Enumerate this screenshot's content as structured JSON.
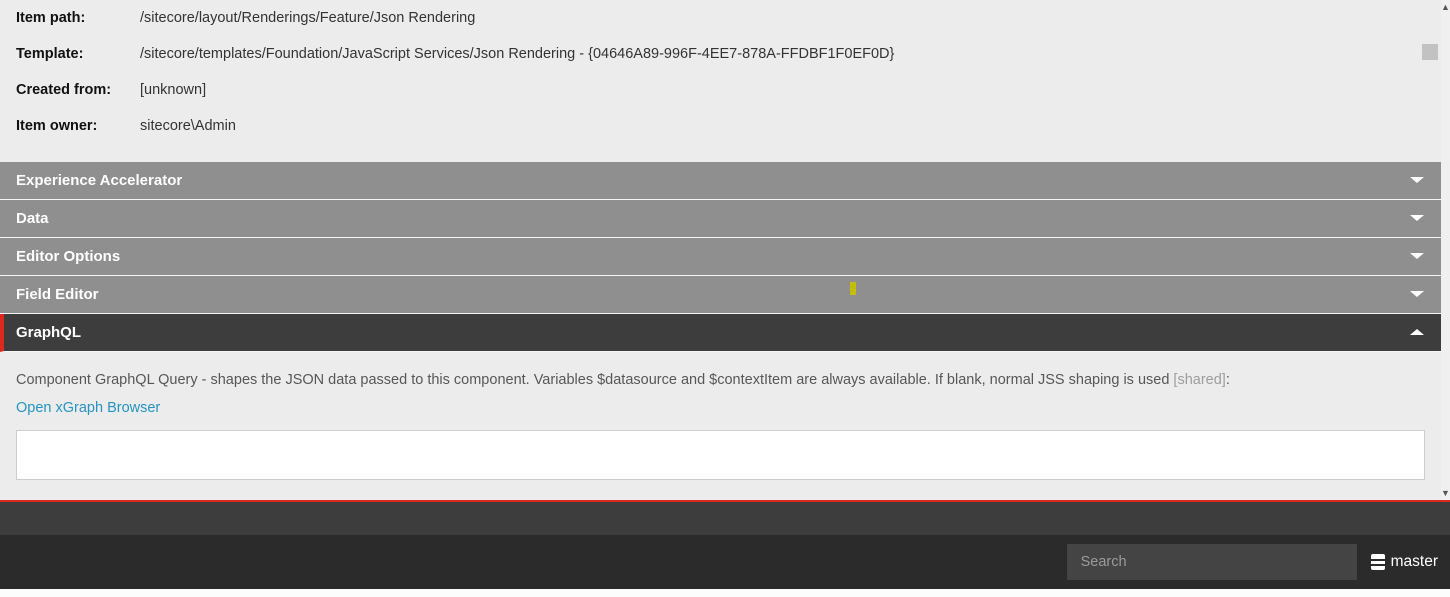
{
  "info": {
    "itemPath": {
      "label": "Item path:",
      "value": "/sitecore/layout/Renderings/Feature/Json Rendering"
    },
    "template": {
      "label": "Template:",
      "value": "/sitecore/templates/Foundation/JavaScript Services/Json Rendering - {04646A89-996F-4EE7-878A-FFDBF1F0EF0D}"
    },
    "createdFrom": {
      "label": "Created from:",
      "value": "[unknown]"
    },
    "itemOwner": {
      "label": "Item owner:",
      "value": "sitecore\\Admin"
    }
  },
  "sections": {
    "xa": "Experience Accelerator",
    "data": "Data",
    "editor": "Editor Options",
    "field": "Field Editor",
    "gql": "GraphQL"
  },
  "graphql": {
    "desc": "Component GraphQL Query - shapes the JSON data passed to this component. Variables $datasource and $contextItem are always available. If blank, normal JSS shaping is used ",
    "shared": "[shared]",
    "colon": ":",
    "link": "Open xGraph Browser",
    "value": ""
  },
  "footer": {
    "searchPlaceholder": "Search",
    "db": "master"
  }
}
